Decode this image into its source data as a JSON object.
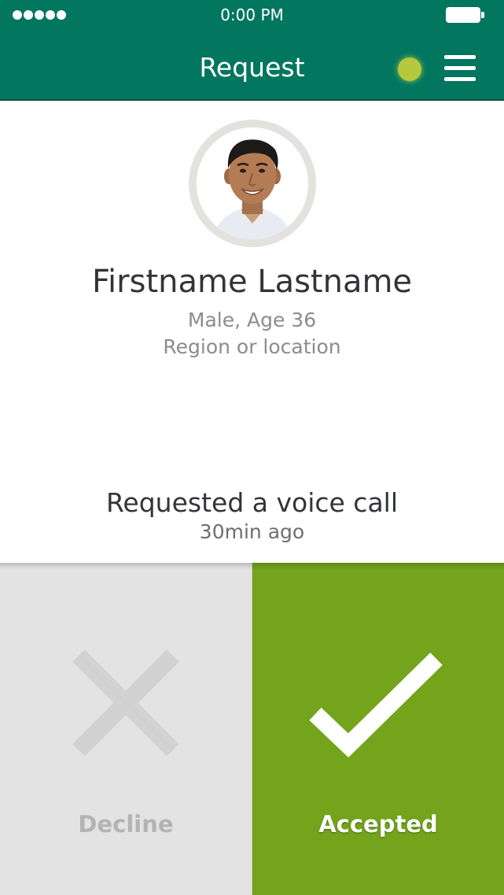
{
  "status_bar": {
    "time": "0:00 PM",
    "signal_icon": "signal-dots-icon",
    "battery_icon": "battery-icon"
  },
  "header": {
    "title": "Request",
    "online_indicator_color": "#b6c93c",
    "menu_icon": "hamburger-menu-icon",
    "background_color": "#02765f"
  },
  "profile": {
    "name": "Firstname Lastname",
    "gender_age": "Male, Age 36",
    "location": "Region or location"
  },
  "request": {
    "description": "Requested a voice call",
    "time_ago": "30min ago"
  },
  "actions": {
    "decline_label": "Decline",
    "decline_icon": "close-x-icon",
    "decline_color": "#e3e3e3",
    "accept_label": "Accepted",
    "accept_icon": "checkmark-icon",
    "accept_color": "#73a41b"
  }
}
